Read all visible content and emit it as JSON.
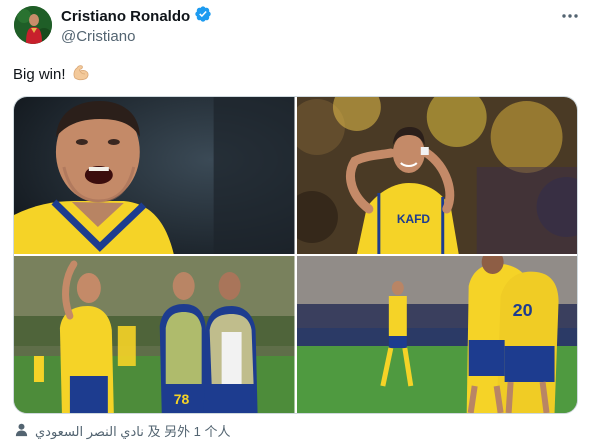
{
  "author": {
    "display_name": "Cristiano Ronaldo",
    "handle": "@Cristiano",
    "verified": true,
    "verified_color": "#1d9bf0"
  },
  "tweet": {
    "text": "Big win!",
    "emoji": "flexed-biceps-icon"
  },
  "media": {
    "count": 4,
    "items": [
      {
        "description_icon": "photo-icon"
      },
      {
        "description_icon": "photo-icon"
      },
      {
        "description_icon": "photo-icon"
      },
      {
        "description_icon": "photo-icon"
      }
    ],
    "jersey_numbers": [
      "78",
      "20"
    ],
    "jersey_text": "KAFD"
  },
  "tags": {
    "icon": "person-icon",
    "text": "نادي النصر السعودي 及 另外 1 个人"
  },
  "colors": {
    "text_primary": "#0f1419",
    "text_secondary": "#536471",
    "kit_yellow": "#f5d327",
    "kit_blue": "#1d3c8f"
  }
}
